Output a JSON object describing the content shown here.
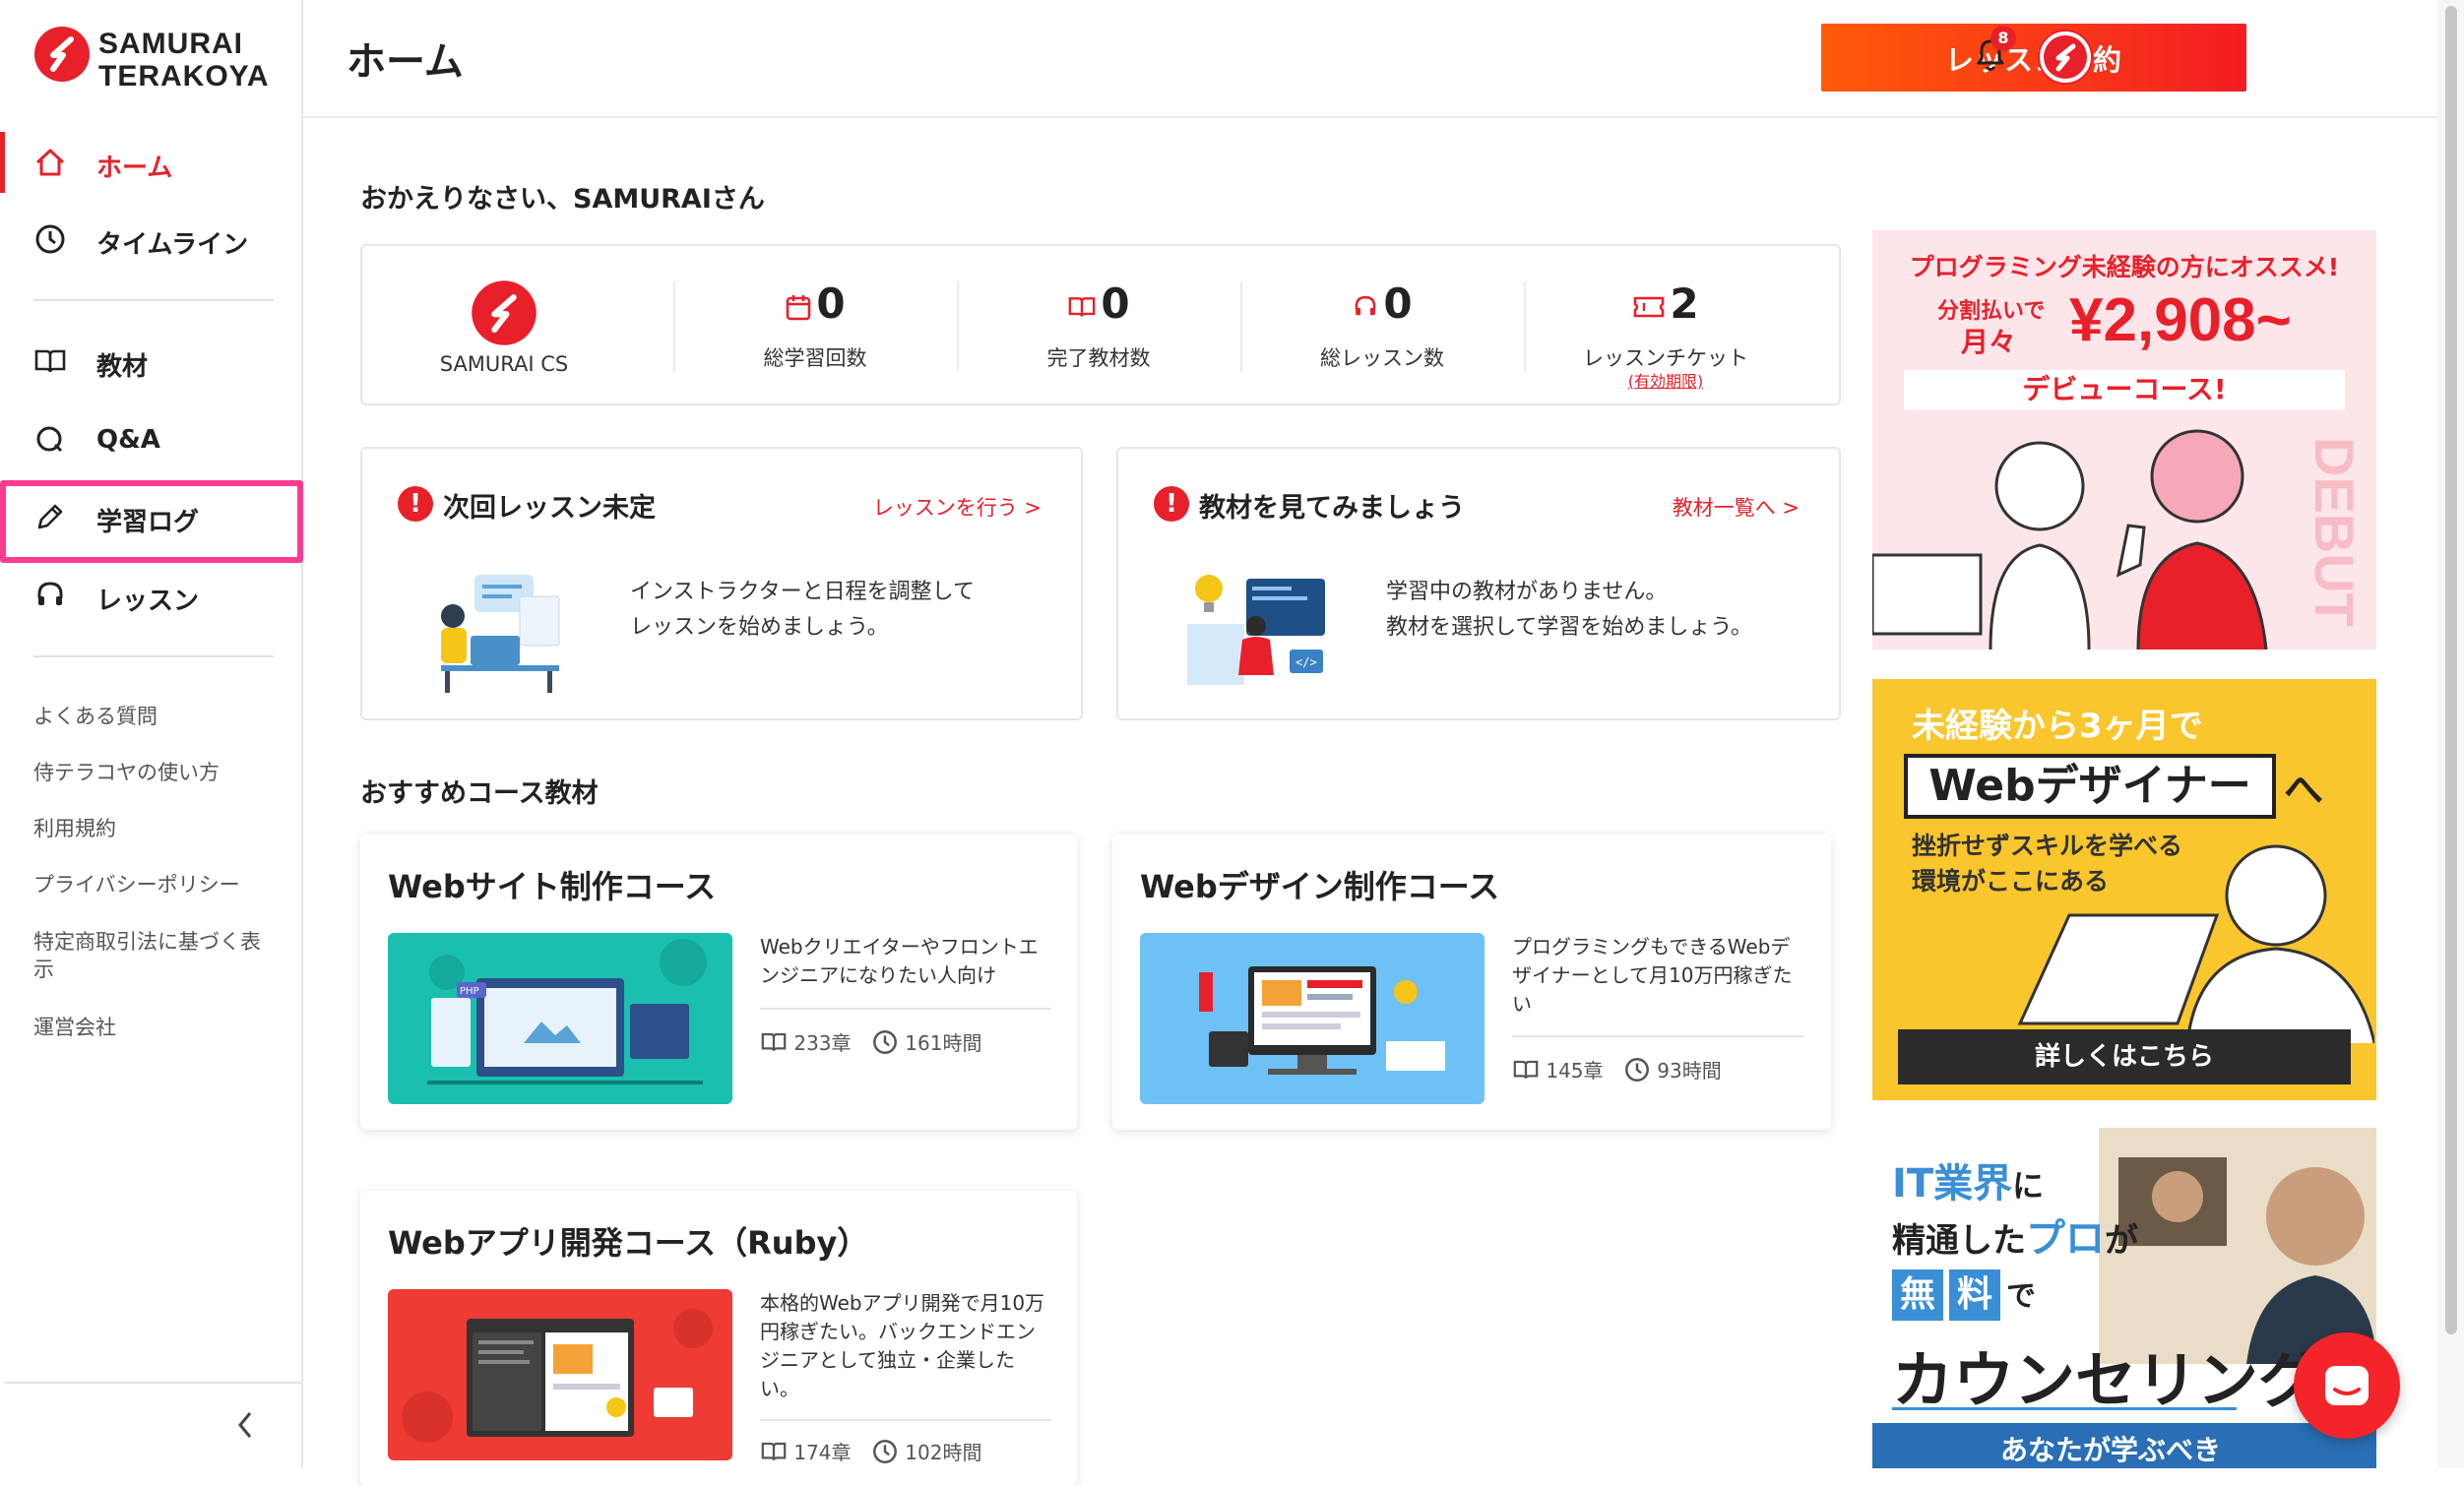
{
  "brand": {
    "line1": "SAMURAI",
    "line2": "TERAKOYA",
    "color": "#e8202a"
  },
  "header": {
    "title": "ホーム",
    "book_button": "レッスン予約",
    "notification_count": "8"
  },
  "sidebar": {
    "main_items": [
      {
        "label": "ホーム",
        "icon": "home-icon",
        "active": true
      },
      {
        "label": "タイムライン",
        "icon": "clock-icon"
      }
    ],
    "learn_items": [
      {
        "label": "教材",
        "icon": "book-icon"
      },
      {
        "label": "Q&A",
        "icon": "qa-icon"
      },
      {
        "label": "学習ログ",
        "icon": "pencil-icon",
        "highlighted": true
      },
      {
        "label": "レッスン",
        "icon": "headset-icon"
      }
    ],
    "footer_links": [
      "よくある質問",
      "侍テラコヤの使い方",
      "利用規約",
      "プライバシーポリシー",
      "特定商取引法に基づく表示",
      "運営会社"
    ]
  },
  "greeting": "おかえりなさい、SAMURAIさん",
  "stats": {
    "user_name": "SAMURAI CS",
    "items": [
      {
        "value": "0",
        "label": "総学習回数",
        "icon": "calendar-icon"
      },
      {
        "value": "0",
        "label": "完了教材数",
        "icon": "book-icon"
      },
      {
        "value": "0",
        "label": "総レッスン数",
        "icon": "headset-icon"
      },
      {
        "value": "2",
        "label": "レッスンチケット",
        "icon": "ticket-icon",
        "sub": "(有効期限)"
      }
    ]
  },
  "cards": [
    {
      "title": "次回レッスン未定",
      "link": "レッスンを行う >",
      "text": [
        "インストラクターと日程を調整して",
        "レッスンを始めましょう。"
      ]
    },
    {
      "title": "教材を見てみましょう",
      "link": "教材一覧へ >",
      "text": [
        "学習中の教材がありません。",
        "教材を選択して学習を始めましょう。"
      ]
    }
  ],
  "recommended": {
    "title": "おすすめコース教材",
    "courses": [
      {
        "title": "Webサイト制作コース",
        "desc": "Webクリエイターやフロントエンジニアになりたい人向け",
        "chapters": "233章",
        "hours": "161時間"
      },
      {
        "title": "Webデザイン制作コース",
        "desc": "プログラミングもできるWebデザイナーとして月10万円稼ぎたい",
        "chapters": "145章",
        "hours": "93時間"
      },
      {
        "title": "Webアプリ開発コース（Ruby）",
        "desc": "本格的Webアプリ開発で月10万円稼ぎたい。バックエンドエンジニアとして独立・企業したい。",
        "chapters": "174章",
        "hours": "102時間"
      }
    ]
  },
  "ads": [
    {
      "line1": "プログラミング未経験の方にオススメ!",
      "line2a": "分割払いで",
      "line2b": "月々",
      "price": "¥2,908~",
      "line3": "デビューコース!",
      "side": "DEBUT"
    },
    {
      "line1": "未経験から3ヶ月で",
      "line2": "Webデザイナー",
      "line2b": "へ",
      "line3": "挫折せずスキルを学べる",
      "line4": "環境がここにある",
      "button": "詳しくはこちら"
    },
    {
      "line1a": "IT業界",
      "line1b": "に",
      "line2a": "精通した",
      "line2b": "プロ",
      "line2c": "が",
      "line3a": "無",
      "line3b": "料",
      "line3c": "で",
      "line4": "カウンセリング",
      "line5": "あなたが学ぶべき"
    }
  ]
}
